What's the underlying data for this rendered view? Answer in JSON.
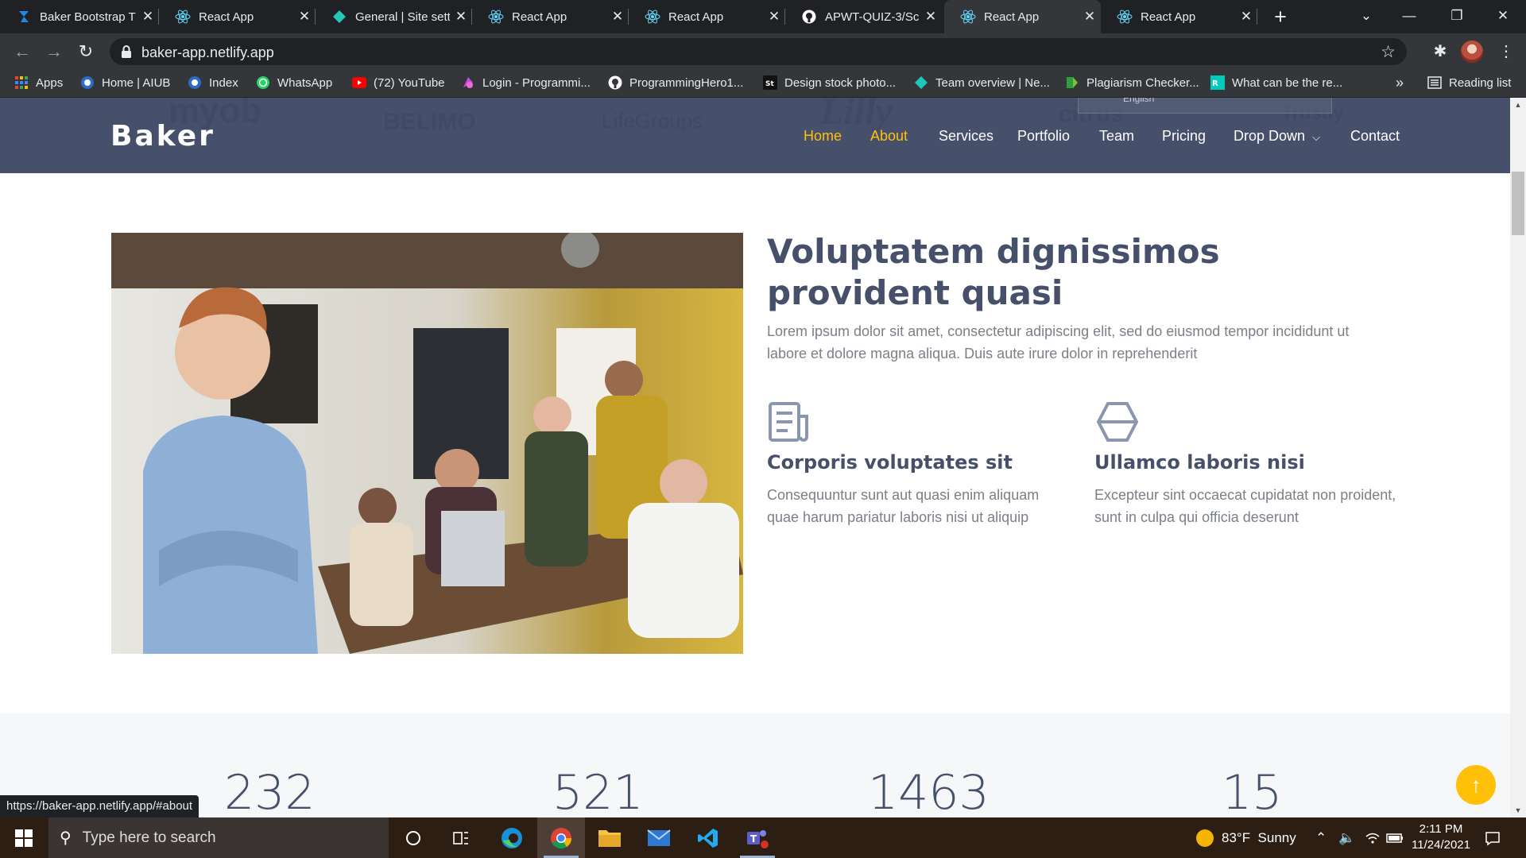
{
  "browser": {
    "tabs": [
      {
        "title": "Baker Bootstrap T",
        "icon": "baker-icon",
        "active": false
      },
      {
        "title": "React App",
        "icon": "react-icon",
        "active": false
      },
      {
        "title": "General | Site sett",
        "icon": "netlify-icon",
        "active": false
      },
      {
        "title": "React App",
        "icon": "react-icon",
        "active": false
      },
      {
        "title": "React App",
        "icon": "react-icon",
        "active": false
      },
      {
        "title": "APWT-QUIZ-3/Sc",
        "icon": "github-icon",
        "active": false
      },
      {
        "title": "React App",
        "icon": "react-icon",
        "active": true
      },
      {
        "title": "React App",
        "icon": "react-icon",
        "active": false
      }
    ],
    "address": "baker-app.netlify.app",
    "bookmarks": [
      {
        "label": "Apps",
        "icon": "apps-grid-icon"
      },
      {
        "label": "Home | AIUB",
        "icon": "aiub-icon"
      },
      {
        "label": "Index",
        "icon": "aiub-icon"
      },
      {
        "label": "WhatsApp",
        "icon": "whatsapp-icon"
      },
      {
        "label": "(72) YouTube",
        "icon": "youtube-icon"
      },
      {
        "label": "Login - Programmi...",
        "icon": "programming-hero-icon"
      },
      {
        "label": "ProgrammingHero1...",
        "icon": "github-icon"
      },
      {
        "label": "Design stock photo...",
        "icon": "shutterstock-icon"
      },
      {
        "label": "Team overview | Ne...",
        "icon": "netlify-icon"
      },
      {
        "label": "Plagiarism Checker...",
        "icon": "plagiarism-icon"
      },
      {
        "label": "What can be the re...",
        "icon": "researchgate-icon"
      }
    ],
    "more_bookmarks": "»",
    "reading_list": "Reading list"
  },
  "site": {
    "brand": "Baker",
    "client_logos": [
      "myob",
      "BELIMO",
      "LifeGroups",
      "Lilly",
      "citrus",
      "Trustly"
    ],
    "nav": [
      {
        "label": "Home",
        "active": true
      },
      {
        "label": "About",
        "active": true
      },
      {
        "label": "Services",
        "active": false
      },
      {
        "label": "Portfolio",
        "active": false
      },
      {
        "label": "Team",
        "active": false
      },
      {
        "label": "Pricing",
        "active": false
      },
      {
        "label": "Drop Down",
        "active": false,
        "dropdown": true
      },
      {
        "label": "Contact",
        "active": false
      }
    ],
    "translate_widget": {
      "language": "English"
    },
    "about": {
      "title": "Voluptatem dignissimos provident quasi",
      "lead": "Lorem ipsum dolor sit amet, consectetur adipiscing elit, sed do eiusmod tempor incididunt ut labore et dolore magna aliqua. Duis aute irure dolor in reprehenderit",
      "features": [
        {
          "icon": "newspaper-icon",
          "title": "Corporis voluptates sit",
          "text": "Consequuntur sunt aut quasi enim aliquam quae harum pariatur laboris nisi ut aliquip"
        },
        {
          "icon": "hexagon-icon",
          "title": "Ullamco laboris nisi",
          "text": "Excepteur sint occaecat cupidatat non proident, sunt in culpa qui officia deserunt"
        }
      ]
    },
    "stats": [
      "232",
      "521",
      "1463",
      "15"
    ],
    "status_url": "https://baker-app.netlify.app/#about",
    "accent_color": "#ffc107",
    "header_color": "#46506a"
  },
  "taskbar": {
    "search_placeholder": "Type here to search",
    "weather": {
      "temp": "83°F",
      "condition": "Sunny"
    },
    "time": "2:11 PM",
    "date": "11/24/2021"
  }
}
